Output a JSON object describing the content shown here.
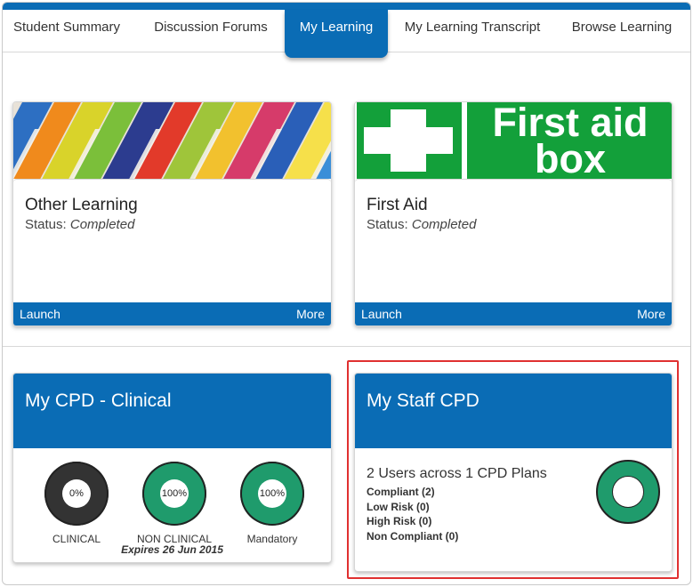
{
  "tabs": [
    {
      "label": "Student Summary",
      "active": false
    },
    {
      "label": "Discussion Forums",
      "active": false
    },
    {
      "label": "My Learning",
      "active": true
    },
    {
      "label": "My Learning Transcript",
      "active": false
    },
    {
      "label": "Browse Learning",
      "active": false
    }
  ],
  "courses": [
    {
      "title": "Other Learning",
      "status_label": "Status:",
      "status": "Completed",
      "launch_label": "Launch",
      "more_label": "More"
    },
    {
      "title": "First Aid",
      "status_label": "Status:",
      "status": "Completed",
      "launch_label": "Launch",
      "more_label": "More",
      "image_text_line1": "First aid",
      "image_text_line2": "box"
    }
  ],
  "cpd_clinical": {
    "title": "My CPD - Clinical",
    "donuts": [
      {
        "label": "CLINICAL",
        "value_text": "0%",
        "percent": 0
      },
      {
        "label": "NON CLINICAL",
        "value_text": "100%",
        "percent": 100
      },
      {
        "label": "Mandatory",
        "value_text": "100%",
        "percent": 100
      }
    ],
    "expires": "Expires 26 Jun 2015"
  },
  "staff_cpd": {
    "title": "My Staff CPD",
    "summary": "2 Users across 1 CPD Plans",
    "stats": [
      "Compliant (2)",
      "Low Risk (0)",
      "High Risk (0)",
      "Non Compliant (0)"
    ]
  },
  "colors": {
    "brand": "#0a6cb5",
    "complete": "#1f9b6c",
    "incomplete": "#333333",
    "highlight": "#e03030",
    "first_aid_green": "#13a03a"
  }
}
